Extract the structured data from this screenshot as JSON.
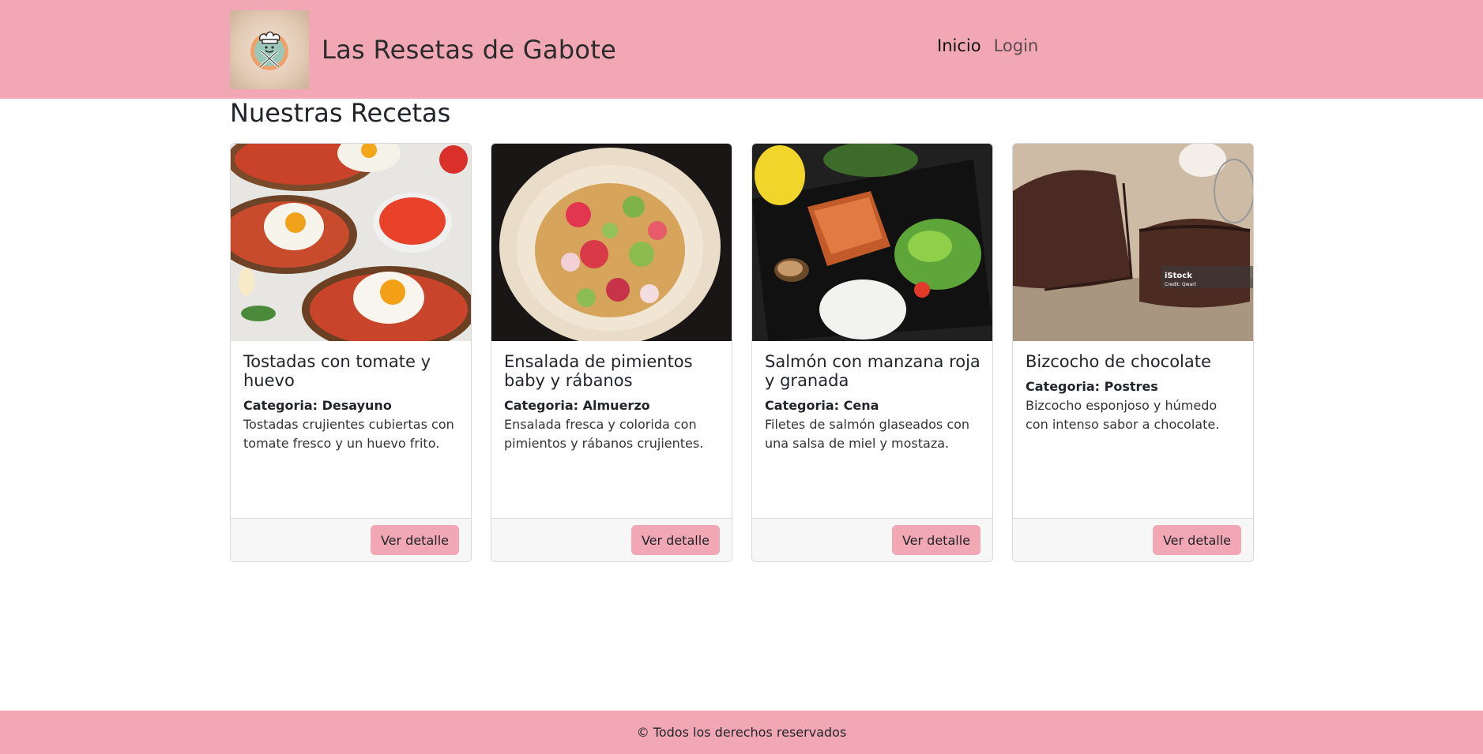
{
  "brand": {
    "name": "Las Resetas de Gabote",
    "logo_icon": "chef-hat-spoon-fork-icon"
  },
  "nav": {
    "items": [
      {
        "label": "Inicio",
        "active": true
      },
      {
        "label": "Login",
        "active": false
      }
    ]
  },
  "page": {
    "title": "Nuestras Recetas"
  },
  "recipes": [
    {
      "title": "Tostadas con tomate y huevo",
      "category_label": "Categoria:",
      "category": "Desayuno",
      "description": "Tostadas crujientes cubiertas con tomate fresco y un huevo frito.",
      "button": "Ver detalle",
      "image_icon": "toast-egg-image"
    },
    {
      "title": "Ensalada de pimientos baby y rábanos",
      "category_label": "Categoria:",
      "category": "Almuerzo",
      "description": "Ensalada fresca y colorida con pimientos y rábanos crujientes.",
      "button": "Ver detalle",
      "image_icon": "salad-bowl-image"
    },
    {
      "title": "Salmón con manzana roja y granada",
      "category_label": "Categoria:",
      "category": "Cena",
      "description": "Filetes de salmón glaseados con una salsa de miel y mostaza.",
      "button": "Ver detalle",
      "image_icon": "salmon-plate-image"
    },
    {
      "title": "Bizcocho de chocolate",
      "category_label": "Categoria:",
      "category": "Postres",
      "description": "Bizcocho esponjoso y húmedo con intenso sabor a chocolate.",
      "button": "Ver detalle",
      "image_icon": "chocolate-cake-image",
      "watermark": "iStock",
      "watermark_credit": "Credit: Qwart"
    }
  ],
  "footer": {
    "text": "© Todos los derechos reservados"
  },
  "colors": {
    "accent": "#f1a7b4",
    "card_footer": "#f7f7f7",
    "border": "#d9d9d9"
  }
}
